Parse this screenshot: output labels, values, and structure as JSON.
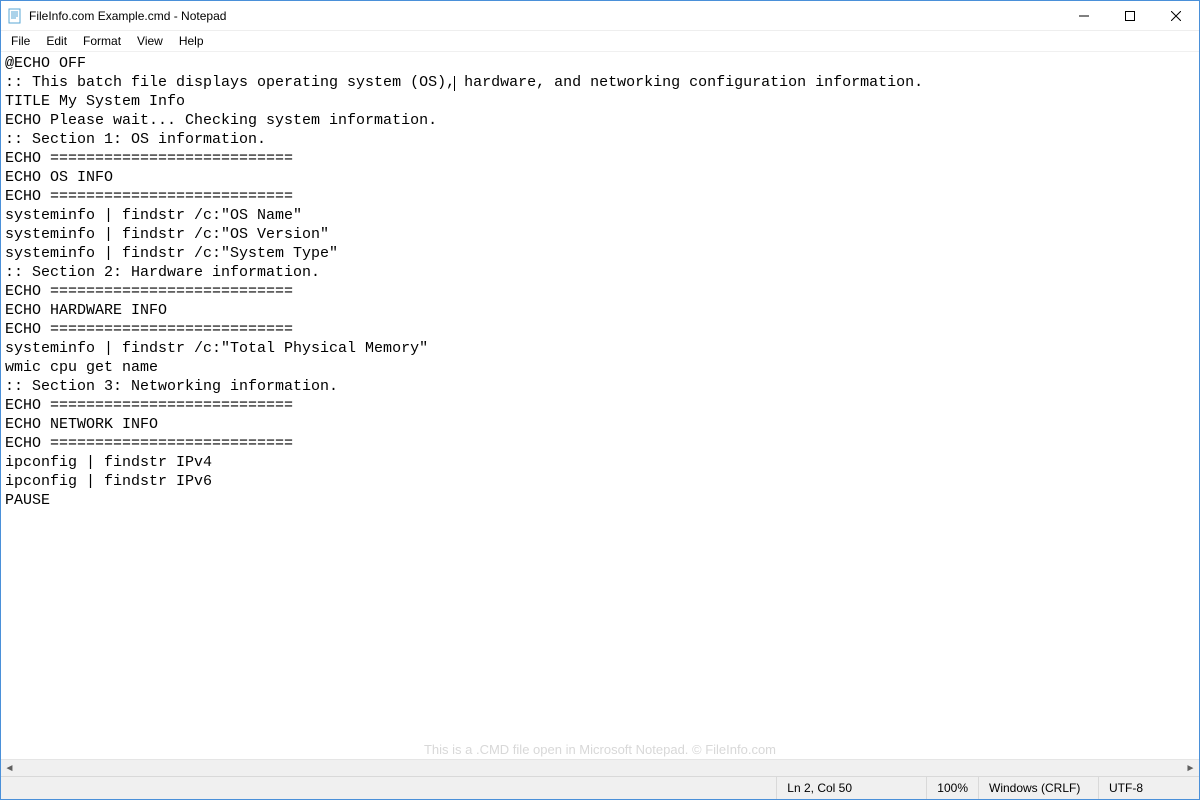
{
  "window": {
    "title": "FileInfo.com Example.cmd - Notepad"
  },
  "menu": {
    "items": [
      "File",
      "Edit",
      "Format",
      "View",
      "Help"
    ]
  },
  "document": {
    "lines": [
      "@ECHO OFF",
      ":: This batch file displays operating system (OS), hardware, and networking configuration information.",
      "TITLE My System Info",
      "ECHO Please wait... Checking system information.",
      ":: Section 1: OS information.",
      "ECHO ===========================",
      "ECHO OS INFO",
      "ECHO ===========================",
      "systeminfo | findstr /c:\"OS Name\"",
      "systeminfo | findstr /c:\"OS Version\"",
      "systeminfo | findstr /c:\"System Type\"",
      ":: Section 2: Hardware information.",
      "ECHO ===========================",
      "ECHO HARDWARE INFO",
      "ECHO ===========================",
      "systeminfo | findstr /c:\"Total Physical Memory\"",
      "wmic cpu get name",
      ":: Section 3: Networking information.",
      "ECHO ===========================",
      "ECHO NETWORK INFO",
      "ECHO ===========================",
      "ipconfig | findstr IPv4",
      "ipconfig | findstr IPv6",
      "PAUSE"
    ],
    "caret_line_index": 1,
    "caret_col_index": 50
  },
  "watermark": "This is a .CMD file open in Microsoft Notepad. © FileInfo.com",
  "status": {
    "position": "Ln 2, Col 50",
    "zoom": "100%",
    "line_ending": "Windows (CRLF)",
    "encoding": "UTF-8"
  }
}
